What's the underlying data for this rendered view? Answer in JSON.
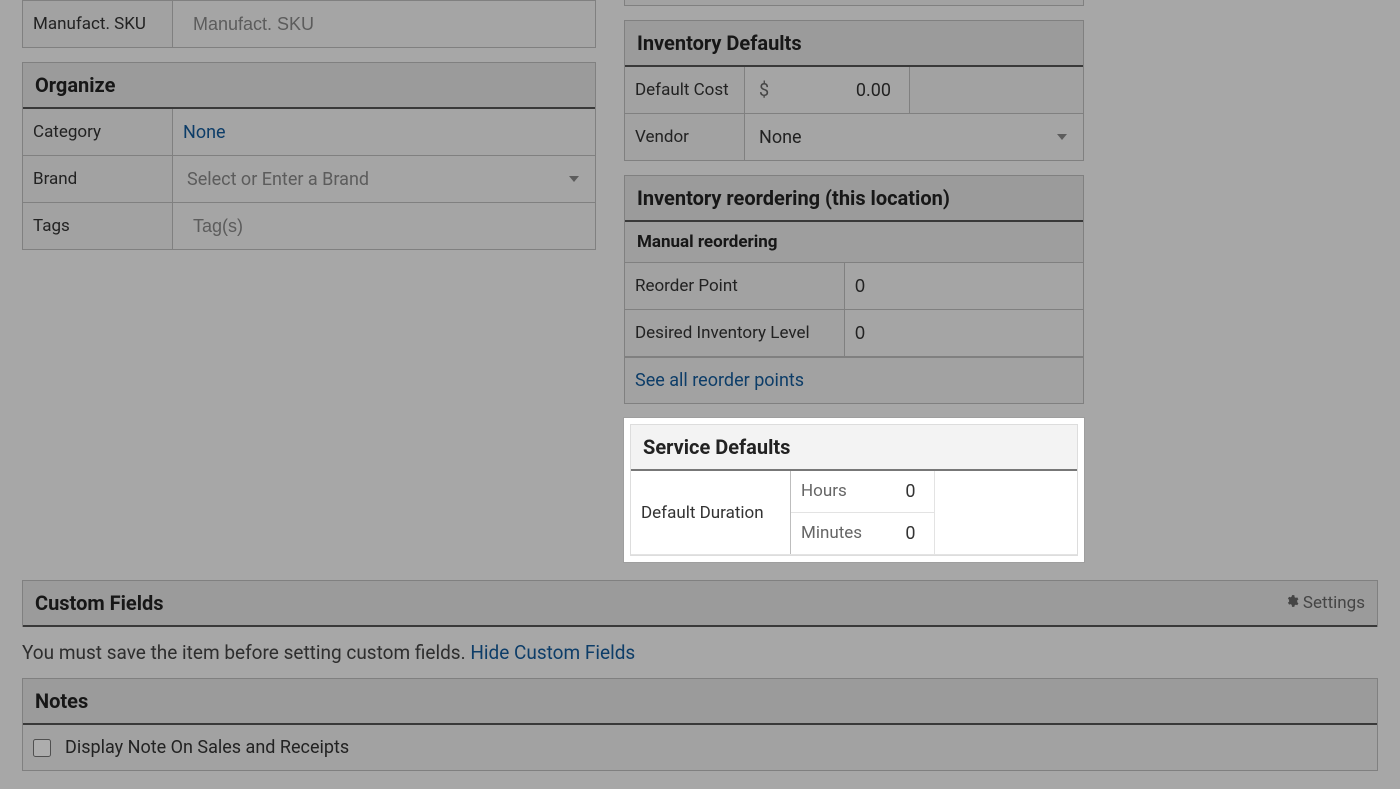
{
  "left": {
    "manufact_sku": {
      "label": "Manufact. SKU",
      "placeholder": "Manufact. SKU"
    },
    "organize": {
      "header": "Organize",
      "category": {
        "label": "Category",
        "value": "None"
      },
      "brand": {
        "label": "Brand",
        "placeholder": "Select or Enter a Brand"
      },
      "tags": {
        "label": "Tags",
        "placeholder": "Tag(s)"
      }
    }
  },
  "right": {
    "inventory_defaults": {
      "header": "Inventory Defaults",
      "default_cost": {
        "label": "Default Cost",
        "currency": "$",
        "value": "0.00"
      },
      "vendor": {
        "label": "Vendor",
        "value": "None"
      }
    },
    "reordering": {
      "header": "Inventory reordering (this location)",
      "subheader": "Manual reordering",
      "reorder_point": {
        "label": "Reorder Point",
        "value": "0"
      },
      "desired_level": {
        "label": "Desired Inventory Level",
        "value": "0"
      },
      "see_all_link": "See all reorder points"
    },
    "service_defaults": {
      "header": "Service Defaults",
      "duration_label": "Default Duration",
      "hours": {
        "label": "Hours",
        "value": "0"
      },
      "minutes": {
        "label": "Minutes",
        "value": "0"
      }
    }
  },
  "custom_fields": {
    "header": "Custom Fields",
    "settings_label": "Settings",
    "body_prefix": "You must save the item before setting custom fields. ",
    "hide_link": "Hide Custom Fields"
  },
  "notes": {
    "header": "Notes",
    "checkbox_label": "Display Note On Sales and Receipts"
  }
}
